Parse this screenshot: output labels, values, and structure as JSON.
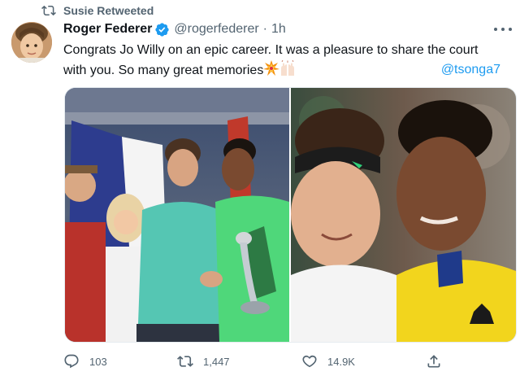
{
  "retweet_banner": {
    "icon": "retweet-icon",
    "text": "Susie Retweeted"
  },
  "tweet": {
    "author_name": "Roger Federer",
    "verified_icon": "verified-badge-icon",
    "handle": "@rogerfederer",
    "separator": "·",
    "time": "1h",
    "text_line1": "Congrats Jo Willy on an epic career. It was a pleasure to share the court",
    "text_line2": "with you. So many great memories",
    "emojis": [
      "collision-emoji",
      "raising-hands-emoji"
    ],
    "mention": "@tsonga7",
    "media": [
      {
        "description_icon": "photo-trophy-ceremony"
      },
      {
        "description_icon": "photo-players-embrace"
      }
    ]
  },
  "actions": {
    "reply_count": "103",
    "retweet_count": "1,447",
    "like_count": "14.9K"
  },
  "colors": {
    "accent": "#1d9bf0",
    "muted": "#536471",
    "text": "#0f1419"
  }
}
